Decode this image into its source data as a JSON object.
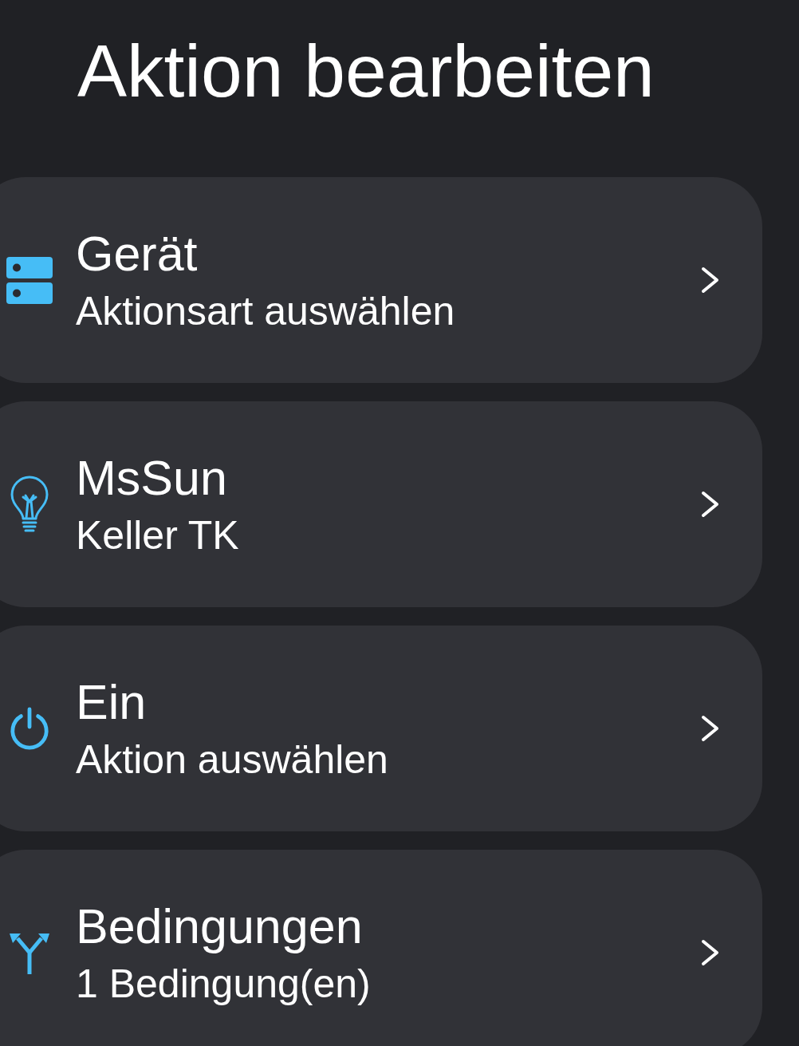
{
  "title": "Aktion bearbeiten",
  "items": [
    {
      "kind": "device",
      "title": "Gerät",
      "subtitle": "Aktionsart auswählen"
    },
    {
      "kind": "target",
      "title": "MsSun",
      "subtitle": "Keller TK"
    },
    {
      "kind": "action",
      "title": "Ein",
      "subtitle": "Aktion auswählen"
    },
    {
      "kind": "conditions",
      "title": "Bedingungen",
      "subtitle": "1 Bedingung(en)"
    }
  ]
}
